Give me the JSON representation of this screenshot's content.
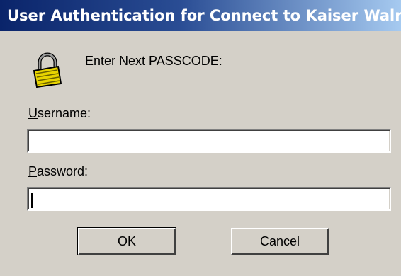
{
  "window": {
    "title": "User Authentication for Connect to Kaiser Waln..."
  },
  "prompt": "Enter Next PASSCODE:",
  "username": {
    "label_accel": "U",
    "label_rest": "sername:",
    "value": ""
  },
  "password": {
    "label_accel": "P",
    "label_rest": "assword:",
    "value": ""
  },
  "buttons": {
    "ok": "OK",
    "cancel": "Cancel"
  },
  "icons": {
    "lock": "padlock-icon"
  },
  "colors": {
    "title_bar_start": "#0a246a",
    "title_bar_end": "#a6caf0",
    "dialog_face": "#d4d0c8",
    "lock_body": "#e8d400"
  }
}
